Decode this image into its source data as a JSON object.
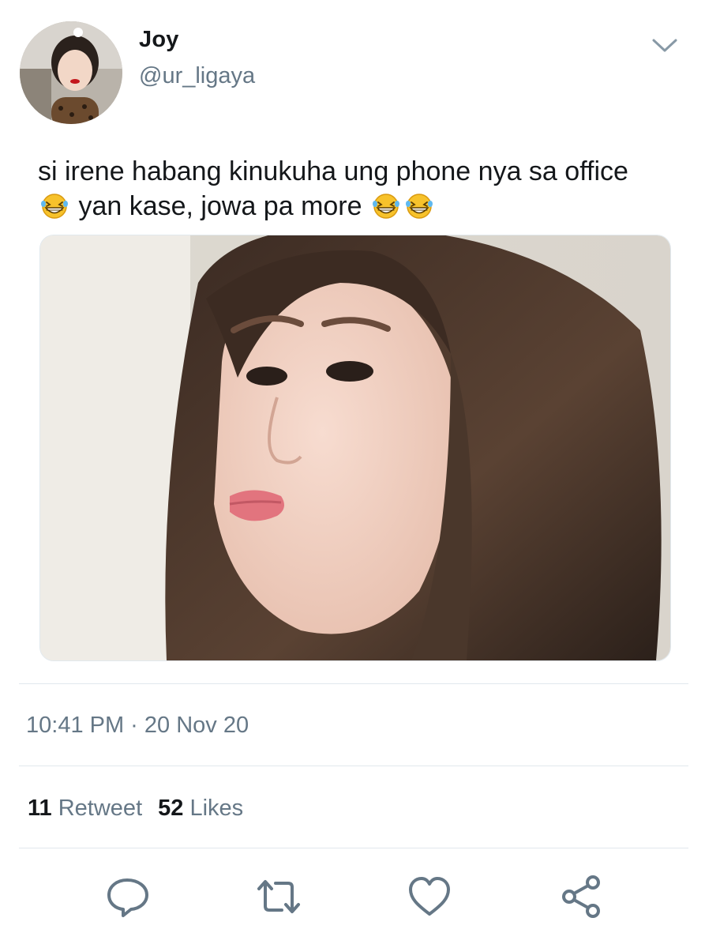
{
  "tweet": {
    "display_name": "Joy",
    "handle": "@ur_ligaya",
    "text_line1": "si irene habang kinukuha ung phone nya sa office",
    "text_line2": "yan kase, jowa pa more",
    "emoji": "grinning-squinting-face-emoji",
    "timestamp": "10:41 PM · 20 Nov 20",
    "retweet_count": "11",
    "retweet_label": "Retweet",
    "like_count": "52",
    "like_label": "Likes"
  },
  "icons": {
    "menu": "chevron-down-icon",
    "reply": "reply-icon",
    "retweet": "retweet-icon",
    "like": "heart-icon",
    "share": "share-icon"
  },
  "colors": {
    "primary_text": "#14171a",
    "secondary_text": "#657786",
    "divider": "#e1e8ed",
    "icon": "#657786"
  }
}
